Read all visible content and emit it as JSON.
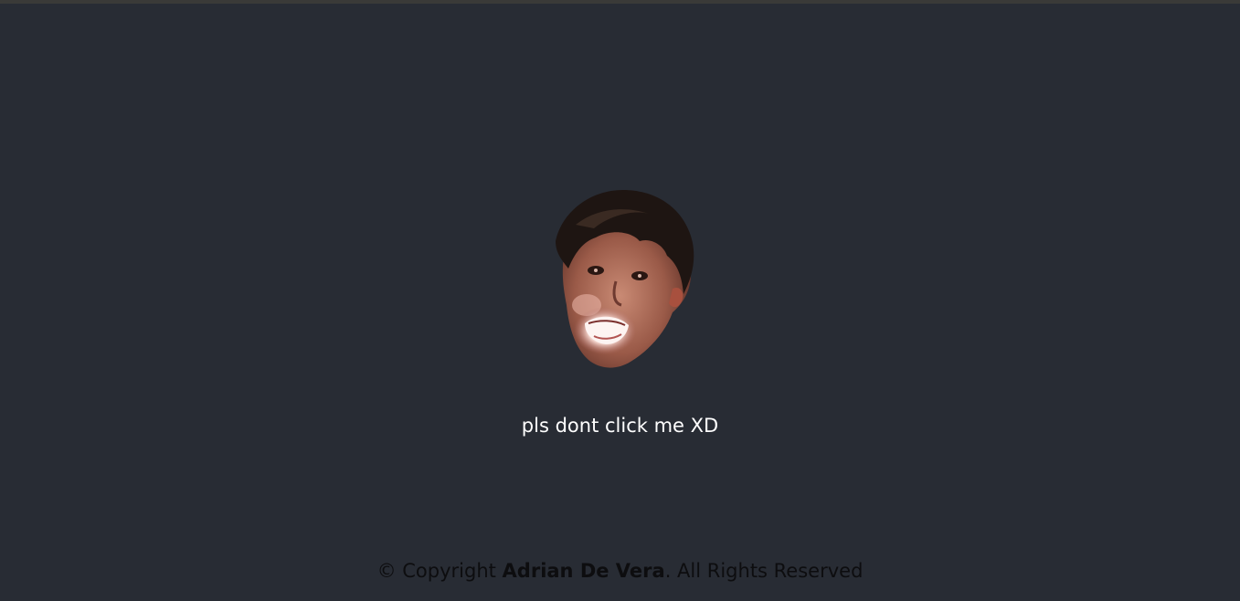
{
  "caption": "pls dont click me XD",
  "footer": {
    "prefix": "© Copyright ",
    "name": "Adrian De Vera",
    "suffix": ". All Rights Reserved"
  },
  "colors": {
    "background": "#282c34",
    "caption": "#ffffff",
    "footer": "#0d0d0f"
  },
  "image": {
    "icon": "face-photo"
  }
}
